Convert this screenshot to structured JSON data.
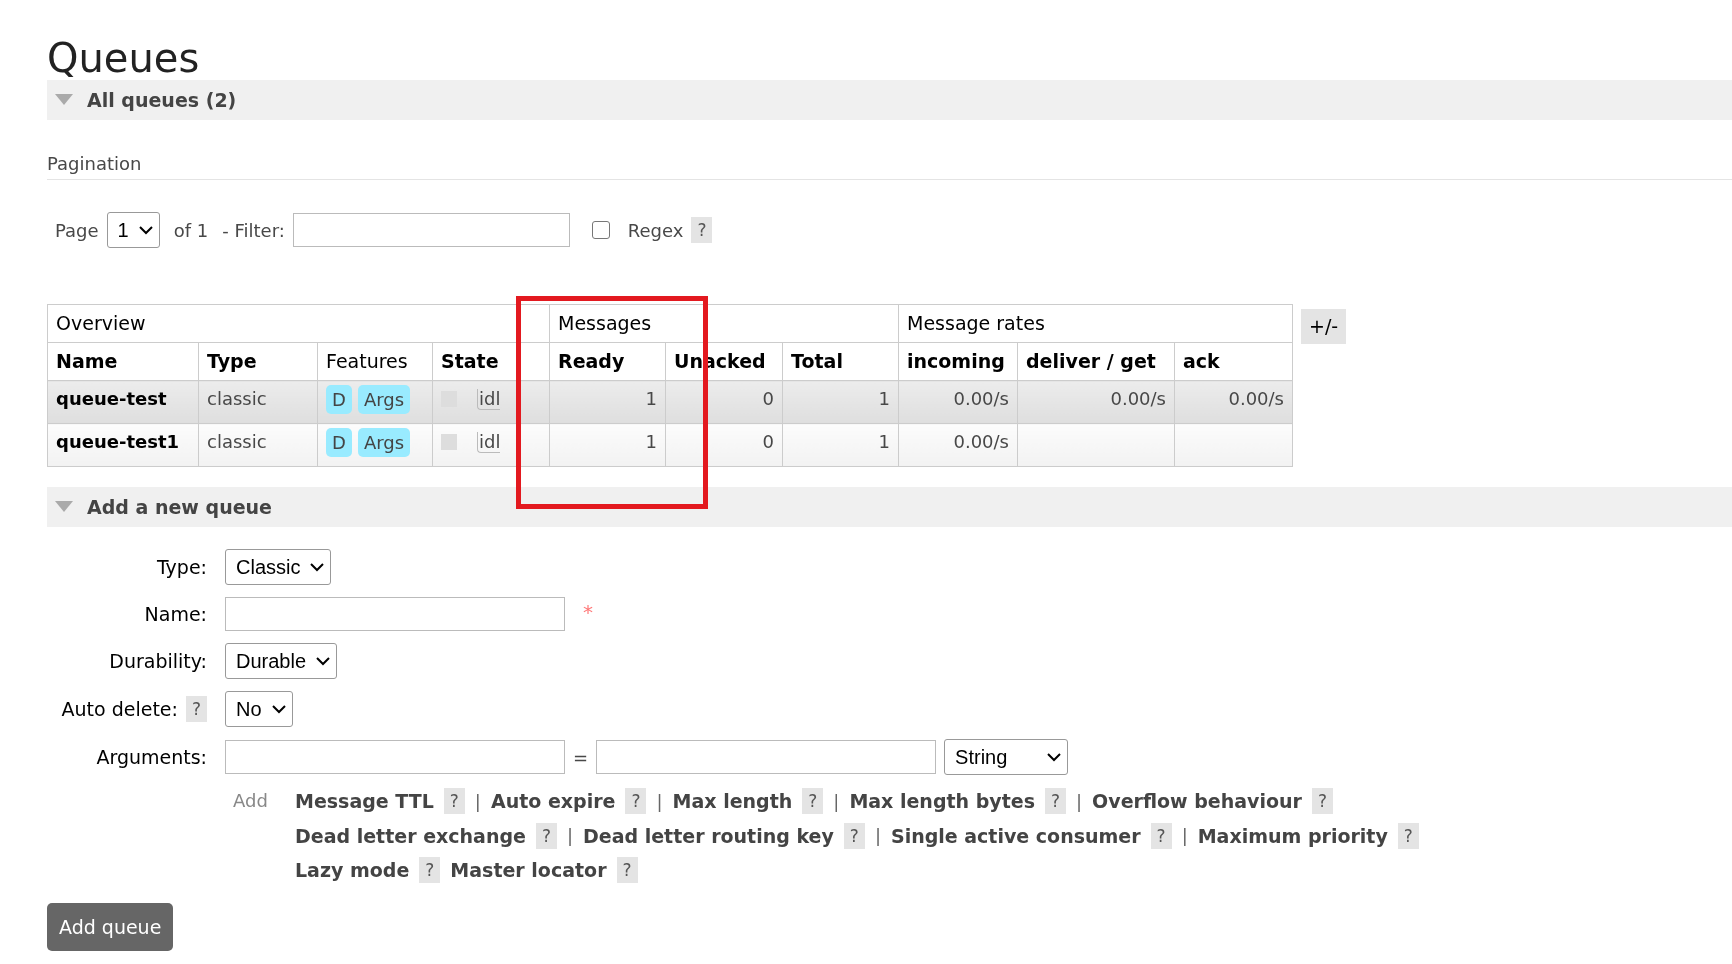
{
  "title": "Queues",
  "all_queues": {
    "heading": "All queues (2)",
    "expanded": true,
    "pagination": {
      "label": "Pagination",
      "page_label": "Page",
      "page": "1",
      "of_label": "of 1",
      "filter_label": "- Filter:",
      "regex": {
        "label": "Regex",
        "checked": false,
        "help": "?"
      }
    },
    "table": {
      "groups": [
        "Overview",
        "Messages",
        "Message rates"
      ],
      "columns": [
        "Name",
        "Type",
        "Features",
        "State",
        "Ready",
        "Unacked",
        "Total",
        "incoming",
        "deliver / get",
        "ack"
      ],
      "rows": [
        {
          "highlighted": true,
          "name": "queue-test",
          "type": "classic",
          "features": [
            "D",
            "Args"
          ],
          "state": "idl",
          "values": [
            "1",
            "0",
            "1",
            "0.00/s",
            "0.00/s",
            "0.00/s"
          ]
        },
        {
          "highlighted": false,
          "name": "queue-test1",
          "type": "classic",
          "features": [
            "D",
            "Args"
          ],
          "state": "idl",
          "values": [
            "1",
            "0",
            "1",
            "0.00/s"
          ]
        }
      ]
    },
    "toggle_button": "+/-",
    "annotations": [
      {
        "kind": "rectangle"
      }
    ]
  },
  "add_queue": {
    "heading": "Add a new queue",
    "expanded": true,
    "fields": [
      {
        "kind": "select",
        "label": "Type:",
        "value": "Classic"
      },
      {
        "kind": "text",
        "label": "Name:",
        "required": "*"
      },
      {
        "kind": "select",
        "label": "Durability:",
        "value": "Durable"
      },
      {
        "kind": "select",
        "label": "Auto delete:",
        "help": "?",
        "value": "No"
      },
      {
        "kind": "arguments",
        "label": "Arguments:",
        "equals": "=",
        "type_value": "String"
      }
    ],
    "add_label": "Add",
    "argument_lines": [
      [
        {
          "label": "Message TTL",
          "help": "?",
          "separator": "|"
        },
        {
          "label": "Auto expire",
          "help": "?",
          "separator": "|"
        },
        {
          "label": "Max length",
          "help": "?",
          "separator": "|"
        },
        {
          "label": "Max length bytes",
          "help": "?",
          "separator": "|"
        },
        {
          "label": "Overflow behaviour",
          "help": "?"
        }
      ],
      [
        {
          "label": "Dead letter exchange",
          "help": "?",
          "separator": "|"
        },
        {
          "label": "Dead letter routing key",
          "help": "?",
          "separator": "|"
        },
        {
          "label": "Single active consumer",
          "help": "?",
          "separator": "|"
        },
        {
          "label": "Maximum priority",
          "help": "?"
        }
      ],
      [
        {
          "label": "Lazy mode",
          "help": "?"
        },
        {
          "label": "Master locator",
          "help": "?"
        }
      ]
    ],
    "submit": "Add queue"
  }
}
